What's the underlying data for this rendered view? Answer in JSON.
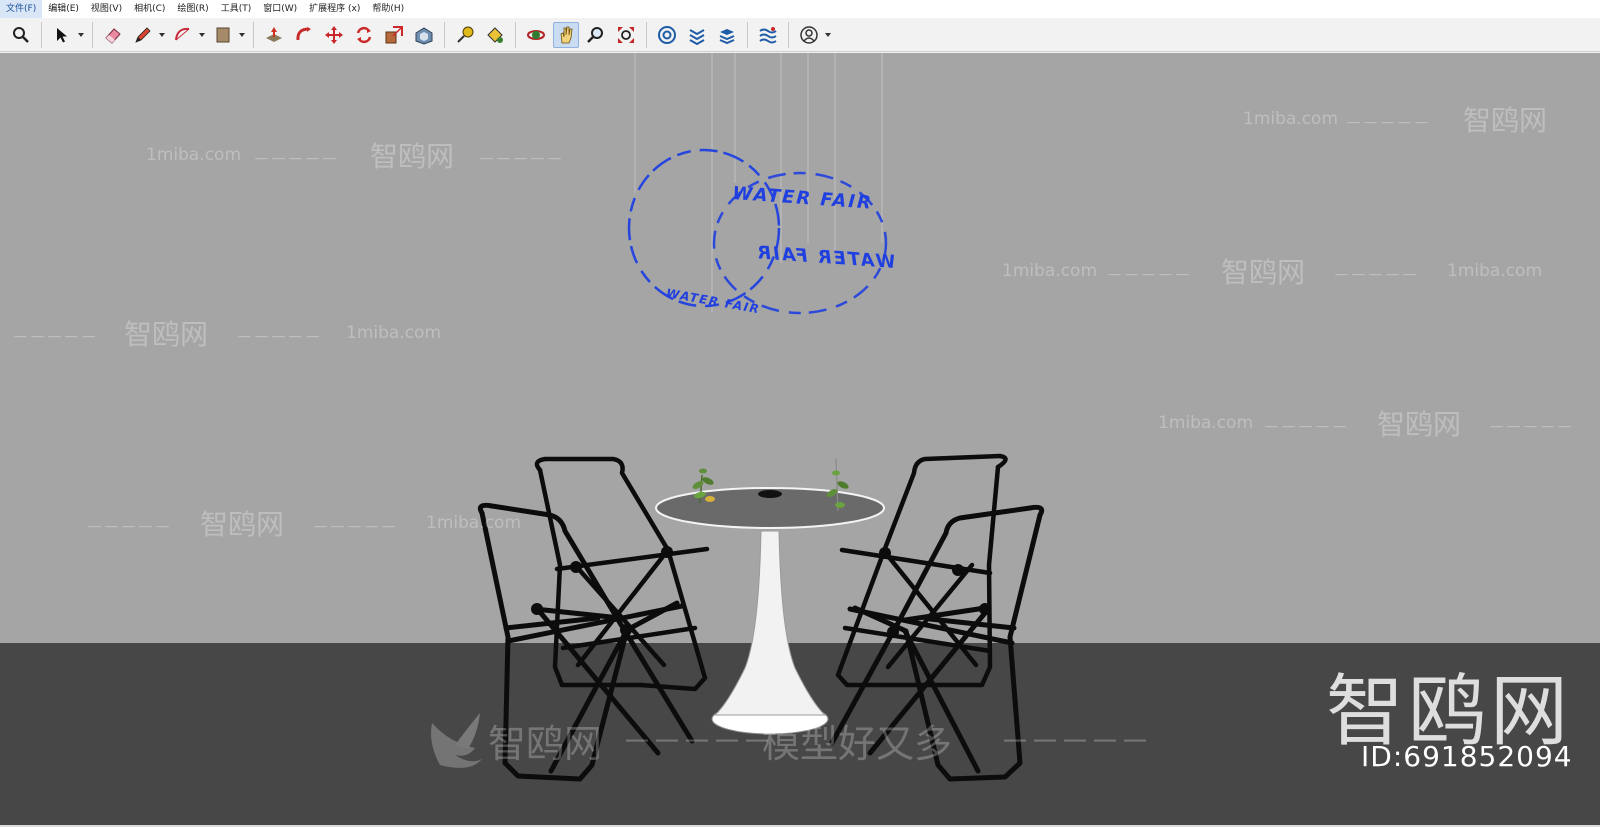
{
  "menu": {
    "items": [
      {
        "label": "文件(F)"
      },
      {
        "label": "编辑(E)"
      },
      {
        "label": "视图(V)"
      },
      {
        "label": "相机(C)"
      },
      {
        "label": "绘图(R)"
      },
      {
        "label": "工具(T)"
      },
      {
        "label": "窗口(W)"
      },
      {
        "label": "扩展程序 (x)"
      },
      {
        "label": "帮助(H)"
      }
    ]
  },
  "toolbar": {
    "tools": [
      "zoom-icon",
      "select-arrow-icon",
      "eraser-icon",
      "pencil-line-icon",
      "arc-icon",
      "rectangle-icon",
      "push-pull-icon",
      "follow-me-icon",
      "move-icon",
      "rotate-icon",
      "scale-icon",
      "offset-icon",
      "tape-measure-icon",
      "paint-bucket-icon",
      "orbit-icon",
      "pan-icon",
      "zoom-window-icon",
      "zoom-extents-icon",
      "3d-warehouse-icon",
      "extension-warehouse-icon",
      "layers-icon",
      "sandbox-icon",
      "account-icon"
    ],
    "active_tool": "pan-icon"
  },
  "model": {
    "sign_text": "WATER FAIR",
    "sign_color": "#1f3fe0"
  },
  "watermarks": {
    "site": "1miba.com",
    "brand": "智鸥网",
    "dashes": "－－－－－",
    "slogan": "模型好又多",
    "big_logo": "智鸥网",
    "id_label": "ID:691852094"
  },
  "colors": {
    "wall": "#a5a5a5",
    "floor": "#474747"
  }
}
